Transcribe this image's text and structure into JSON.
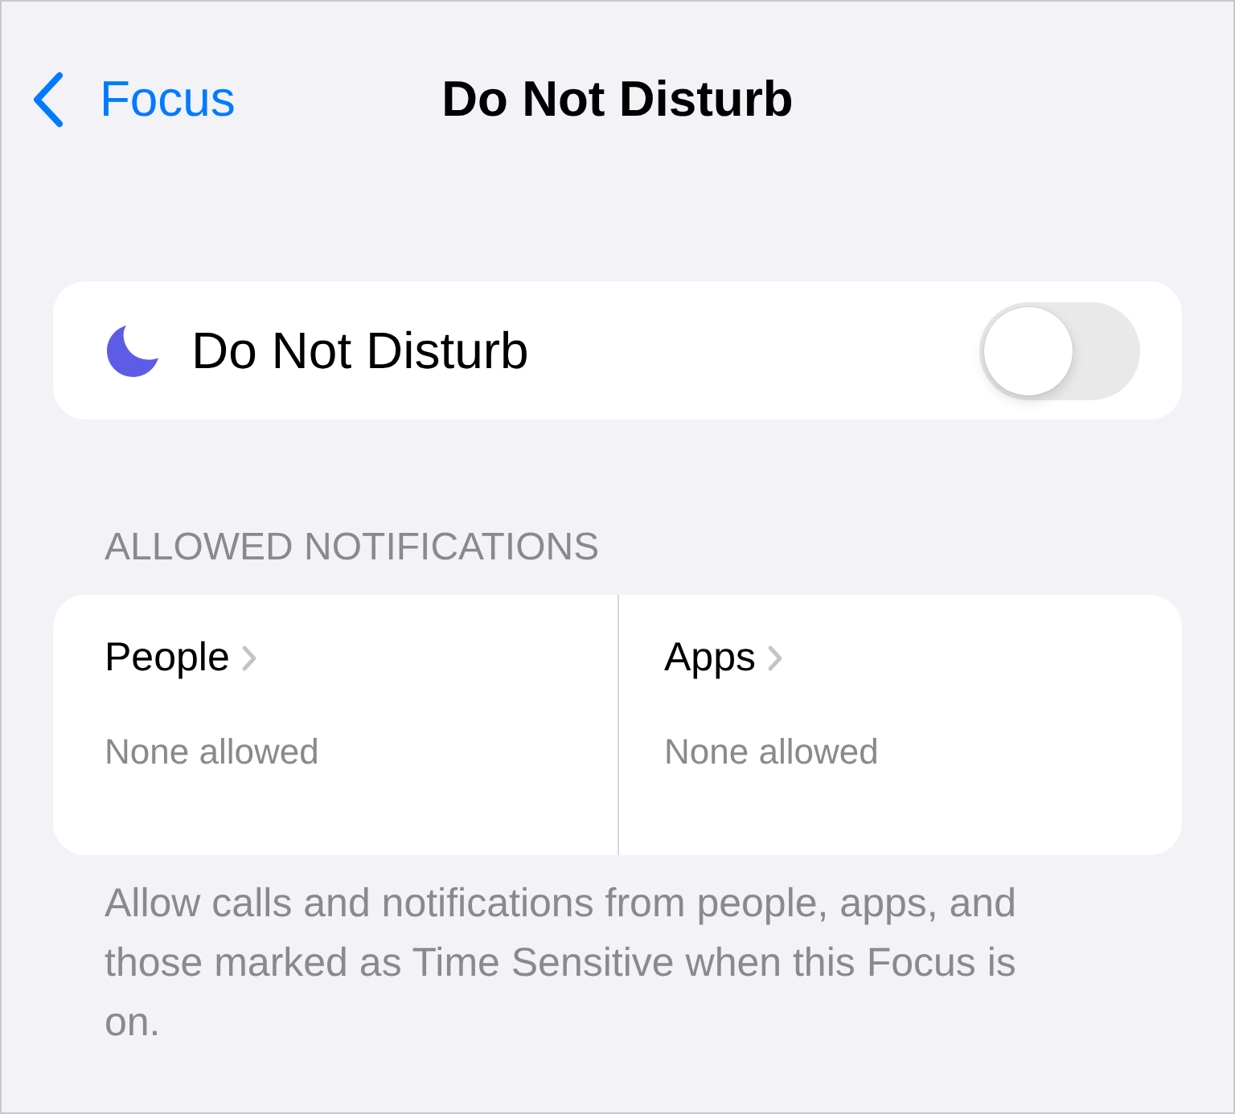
{
  "nav": {
    "back_label": "Focus",
    "title": "Do Not Disturb"
  },
  "focus_toggle": {
    "label": "Do Not Disturb",
    "on": false
  },
  "allowed_notifications": {
    "header": "ALLOWED NOTIFICATIONS",
    "items": [
      {
        "label": "People",
        "value": "None allowed"
      },
      {
        "label": "Apps",
        "value": "None allowed"
      }
    ]
  },
  "footer": "Allow calls and notifications from people, apps, and those marked as Time Sensitive when this Focus is on."
}
